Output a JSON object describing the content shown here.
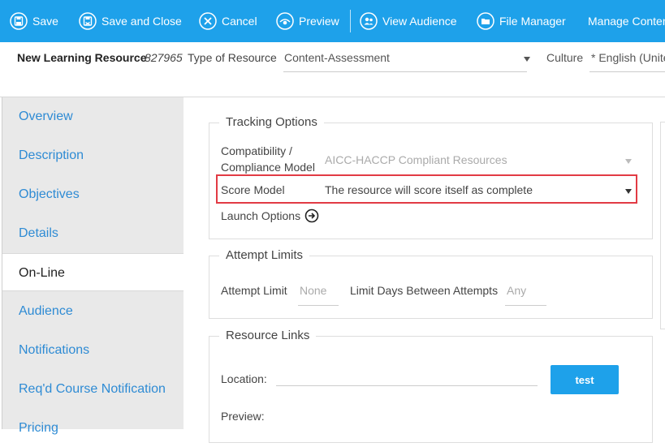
{
  "toolbar": {
    "save": "Save",
    "save_close": "Save and Close",
    "cancel": "Cancel",
    "preview": "Preview",
    "view_audience": "View Audience",
    "file_manager": "File Manager",
    "manage_content": "Manage Conten"
  },
  "resource": {
    "title": "New Learning Resource",
    "id": "827965",
    "type_label": "Type of Resource",
    "type_value": "Content-Assessment",
    "culture_label": "Culture",
    "culture_value": "* English (Unite"
  },
  "sidebar": {
    "items": [
      {
        "label": "Overview"
      },
      {
        "label": "Description"
      },
      {
        "label": "Objectives"
      },
      {
        "label": "Details"
      },
      {
        "label": "On-Line"
      },
      {
        "label": "Audience"
      },
      {
        "label": "Notifications"
      },
      {
        "label": "Req'd Course Notification"
      },
      {
        "label": "Pricing"
      }
    ],
    "active": "On-Line"
  },
  "tracking": {
    "legend": "Tracking Options",
    "compat_label_1": "Compatibility /",
    "compat_label_2": "Compliance Model",
    "compat_value": "AICC-HACCP Compliant Resources",
    "score_label": "Score Model",
    "score_value": "The resource will score itself as complete",
    "launch_label": "Launch Options"
  },
  "attempts": {
    "legend": "Attempt Limits",
    "limit_label": "Attempt Limit",
    "limit_value": "None",
    "days_label": "Limit Days Between Attempts",
    "days_value": "Any"
  },
  "links": {
    "legend": "Resource Links",
    "location_label": "Location:",
    "preview_label": "Preview:",
    "test_button": "test"
  },
  "colors": {
    "toolbar": "#1ea1ea",
    "highlight": "#e23b44",
    "nav_link": "#2e8bd4"
  }
}
